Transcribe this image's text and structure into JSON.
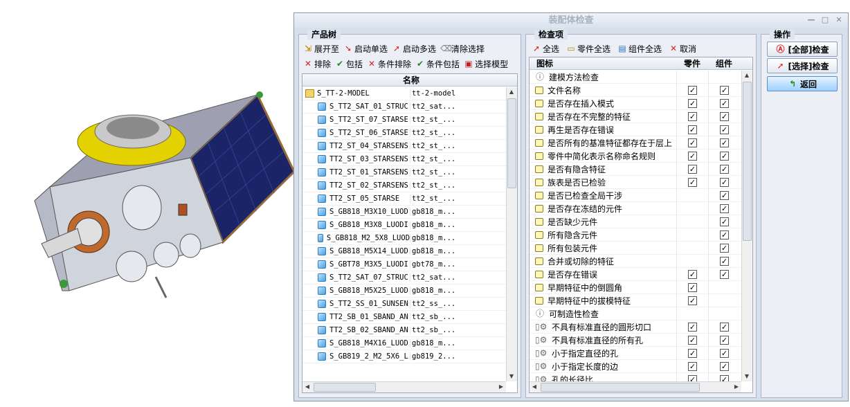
{
  "window": {
    "title": "装配体检查"
  },
  "tree_panel": {
    "title": "产品树",
    "toolbar1": [
      {
        "label": "展开至",
        "icon": "expand-icon"
      },
      {
        "label": "启动单选",
        "icon": "cursor-single-icon"
      },
      {
        "label": "启动多选",
        "icon": "cursor-multi-icon"
      },
      {
        "label": "清除选择",
        "icon": "eraser-icon"
      }
    ],
    "toolbar2": [
      {
        "label": "排除",
        "icon": "x-icon"
      },
      {
        "label": "包括",
        "icon": "check-icon"
      },
      {
        "label": "条件排除",
        "icon": "x-icon"
      },
      {
        "label": "条件包括",
        "icon": "check-icon"
      },
      {
        "label": "选择模型",
        "icon": "select-model-icon"
      }
    ],
    "column_header": "名称",
    "rows": [
      {
        "name": "S_TT-2-MODEL",
        "file": "tt-2-model",
        "root": true
      },
      {
        "name": "S_TT2_SAT_01_STRUC",
        "file": "tt2_sat..."
      },
      {
        "name": "S_TT2_ST_07_STARSE",
        "file": "tt2_st_..."
      },
      {
        "name": "S_TT2_ST_06_STARSE",
        "file": "tt2_st_..."
      },
      {
        "name": "TT2_ST_04_STARSENS",
        "file": "tt2_st_..."
      },
      {
        "name": "TT2_ST_03_STARSENS",
        "file": "tt2_st_..."
      },
      {
        "name": "TT2_ST_01_STARSENS",
        "file": "tt2_st_..."
      },
      {
        "name": "TT2_ST_02_STARSENS",
        "file": "tt2_st_..."
      },
      {
        "name": "TT2_ST_05_STARSE",
        "file": "tt2_st_..."
      },
      {
        "name": "S_GB818_M3X10_LUOD",
        "file": "gb818_m..."
      },
      {
        "name": "S_GB818_M3X8_LUODI",
        "file": "gb818_m..."
      },
      {
        "name": "S_GB818_M2_5X8_LUOD",
        "file": "gb818_m..."
      },
      {
        "name": "S_GB818_M5X14_LUOD",
        "file": "gb818_m..."
      },
      {
        "name": "S_GBT78_M3X5_LUODI",
        "file": "gbt78_m..."
      },
      {
        "name": "S_TT2_SAT_07_STRUC",
        "file": "tt2_sat..."
      },
      {
        "name": "S_GB818_M5X25_LUOD",
        "file": "gb818_m..."
      },
      {
        "name": "S_TT2_SS_01_SUNSEN",
        "file": "tt2_ss_..."
      },
      {
        "name": "TT2_SB_01_SBAND_AN",
        "file": "tt2_sb_..."
      },
      {
        "name": "TT2_SB_02_SBAND_AN",
        "file": "tt2_sb_..."
      },
      {
        "name": "S_GB818_M4X16_LUOD",
        "file": "gb818_m..."
      },
      {
        "name": "S_GB819_2_M2_5X6_L",
        "file": "gb819_2..."
      }
    ]
  },
  "check_panel": {
    "title": "检查项",
    "toolbar": [
      {
        "label": "全选",
        "icon": "cursor-multi-icon"
      },
      {
        "label": "零件全选",
        "icon": "part-icon"
      },
      {
        "label": "组件全选",
        "icon": "assembly-icon"
      },
      {
        "label": "取消",
        "icon": "x-icon"
      }
    ],
    "headers": {
      "icon": "图标",
      "part": "零件",
      "assembly": "组件"
    },
    "rows": [
      {
        "type": "group",
        "label": "建模方法检查",
        "part": false,
        "asm": false
      },
      {
        "type": "item",
        "label": "文件名称",
        "part": true,
        "asm": true
      },
      {
        "type": "item",
        "label": "是否存在插入模式",
        "part": true,
        "asm": true
      },
      {
        "type": "item",
        "label": "是否存在不完整的特征",
        "part": true,
        "asm": true
      },
      {
        "type": "item",
        "label": "再生是否存在错误",
        "part": true,
        "asm": true
      },
      {
        "type": "item",
        "label": "是否所有的基准特征都存在于层上",
        "part": true,
        "asm": true
      },
      {
        "type": "item",
        "label": "零件中简化表示名称命名规则",
        "part": true,
        "asm": true
      },
      {
        "type": "item",
        "label": "是否有隐含特征",
        "part": true,
        "asm": true
      },
      {
        "type": "item",
        "label": "族表是否已检验",
        "part": true,
        "asm": true
      },
      {
        "type": "item",
        "label": "是否已检查全局干涉",
        "part": false,
        "asm": true
      },
      {
        "type": "item",
        "label": "是否存在冻结的元件",
        "part": false,
        "asm": true
      },
      {
        "type": "item",
        "label": "是否缺少元件",
        "part": false,
        "asm": true
      },
      {
        "type": "item",
        "label": "所有隐含元件",
        "part": false,
        "asm": true
      },
      {
        "type": "item",
        "label": "所有包装元件",
        "part": false,
        "asm": true
      },
      {
        "type": "item",
        "label": "合并或切除的特征",
        "part": false,
        "asm": true
      },
      {
        "type": "item",
        "label": "是否存在错误",
        "part": true,
        "asm": true
      },
      {
        "type": "item",
        "label": "早期特征中的倒圆角",
        "part": true,
        "asm": false
      },
      {
        "type": "item",
        "label": "早期特征中的拔模特征",
        "part": true,
        "asm": false
      },
      {
        "type": "group",
        "label": "可制造性检查",
        "part": false,
        "asm": false
      },
      {
        "type": "gear",
        "label": "不具有标准直径的圆形切口",
        "part": true,
        "asm": true
      },
      {
        "type": "gear",
        "label": "不具有标准直径的所有孔",
        "part": true,
        "asm": true
      },
      {
        "type": "gear",
        "label": "小于指定直径的孔",
        "part": true,
        "asm": true
      },
      {
        "type": "gear",
        "label": "小于指定长度的边",
        "part": true,
        "asm": true
      },
      {
        "type": "gear",
        "label": "孔的长径比",
        "part": true,
        "asm": true
      }
    ]
  },
  "ops_panel": {
    "title": "操作",
    "buttons": [
      {
        "label": "[全部]检查",
        "icon": "check-all-icon"
      },
      {
        "label": "[选择]检查",
        "icon": "check-selected-icon"
      },
      {
        "label": "返回",
        "icon": "return-icon"
      }
    ]
  },
  "colors": {
    "accent": "#d6dfea",
    "active_button": "#9fd0ff",
    "check_red": "#d22",
    "check_green": "#1a8a1a"
  }
}
